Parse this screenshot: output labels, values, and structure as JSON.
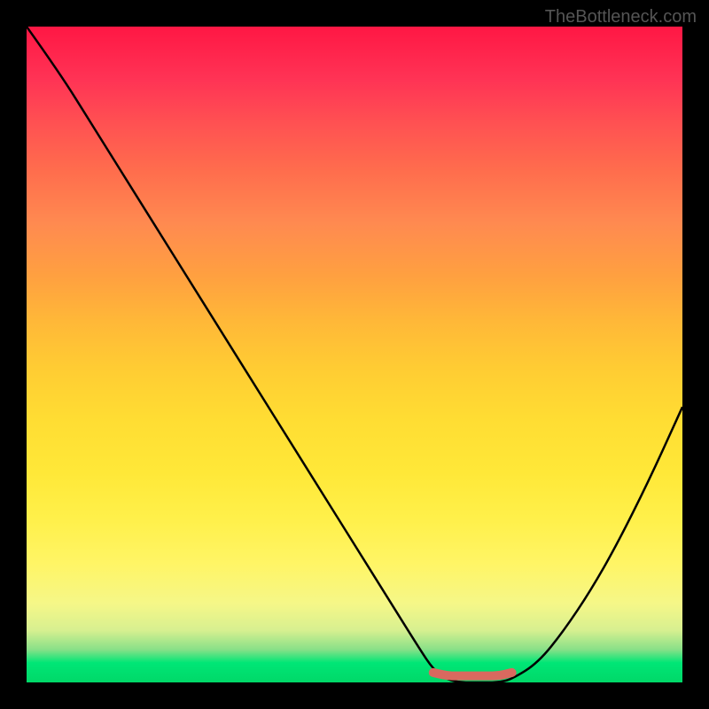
{
  "watermark": "TheBottleneck.com",
  "chart_data": {
    "type": "line",
    "title": "",
    "xlabel": "",
    "ylabel": "",
    "xlim": [
      0,
      100
    ],
    "ylim": [
      0,
      100
    ],
    "series": [
      {
        "name": "bottleneck-curve",
        "x": [
          0,
          5,
          10,
          15,
          20,
          25,
          30,
          35,
          40,
          45,
          50,
          55,
          60,
          62,
          64,
          66,
          68,
          70,
          72,
          74,
          78,
          82,
          86,
          90,
          95,
          100
        ],
        "y": [
          100,
          93,
          85,
          77,
          69,
          61,
          53,
          45,
          37,
          29,
          21,
          13,
          5,
          2,
          0.5,
          0,
          0,
          0,
          0,
          0.5,
          3,
          8,
          14,
          21,
          31,
          42
        ]
      },
      {
        "name": "optimal-marker",
        "x": [
          62,
          64,
          66,
          68,
          70,
          72,
          74
        ],
        "y": [
          1.5,
          1,
          1,
          1,
          1,
          1,
          1.5
        ]
      }
    ],
    "gradient_stops": [
      {
        "pos": 0,
        "color": "#ff1744"
      },
      {
        "pos": 50,
        "color": "#ffcc33"
      },
      {
        "pos": 100,
        "color": "#00d868"
      }
    ]
  }
}
